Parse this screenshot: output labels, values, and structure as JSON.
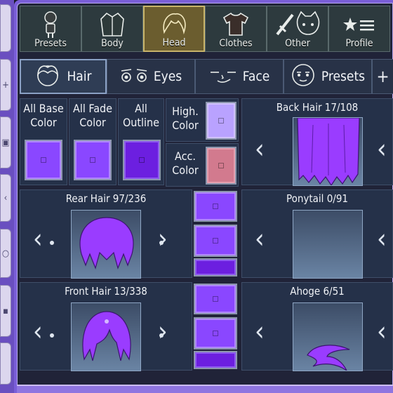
{
  "colors": {
    "accent_purple": "#8a47ff",
    "dark_purple": "#6c1fe0",
    "highlight_lavender": "#b9a2ff",
    "accessory_pink": "#d27a8e",
    "active_tab": "#6b5d2f"
  },
  "categories": [
    {
      "label": "Presets",
      "icon": "person-icon"
    },
    {
      "label": "Body",
      "icon": "jacket-icon"
    },
    {
      "label": "Head",
      "icon": "hair-icon"
    },
    {
      "label": "Clothes",
      "icon": "shirt-icon"
    },
    {
      "label": "Other",
      "icon": "sword-cat-icon"
    },
    {
      "label": "Profile",
      "icon": "star-list-icon"
    }
  ],
  "subtabs": [
    {
      "label": "Hair",
      "icon": "hair-face-icon"
    },
    {
      "label": "Eyes",
      "icon": "eyes-icon"
    },
    {
      "label": "Face",
      "icon": "face-icon"
    },
    {
      "label": "Presets",
      "icon": "presets-face-icon"
    }
  ],
  "colors_panel": {
    "all_base": "All Base\nColor",
    "all_fade": "All Fade\nColor",
    "all_outline": "All\nOutline",
    "high": "High.\nColor",
    "acc": "Acc.\nColor"
  },
  "parts": {
    "back_hair": "Back Hair 17/108",
    "rear_hair": "Rear Hair 97/236",
    "ponytail": "Ponytail 0/91",
    "front_hair": "Front Hair 13/338",
    "ahoge": "Ahoge 6/51"
  }
}
